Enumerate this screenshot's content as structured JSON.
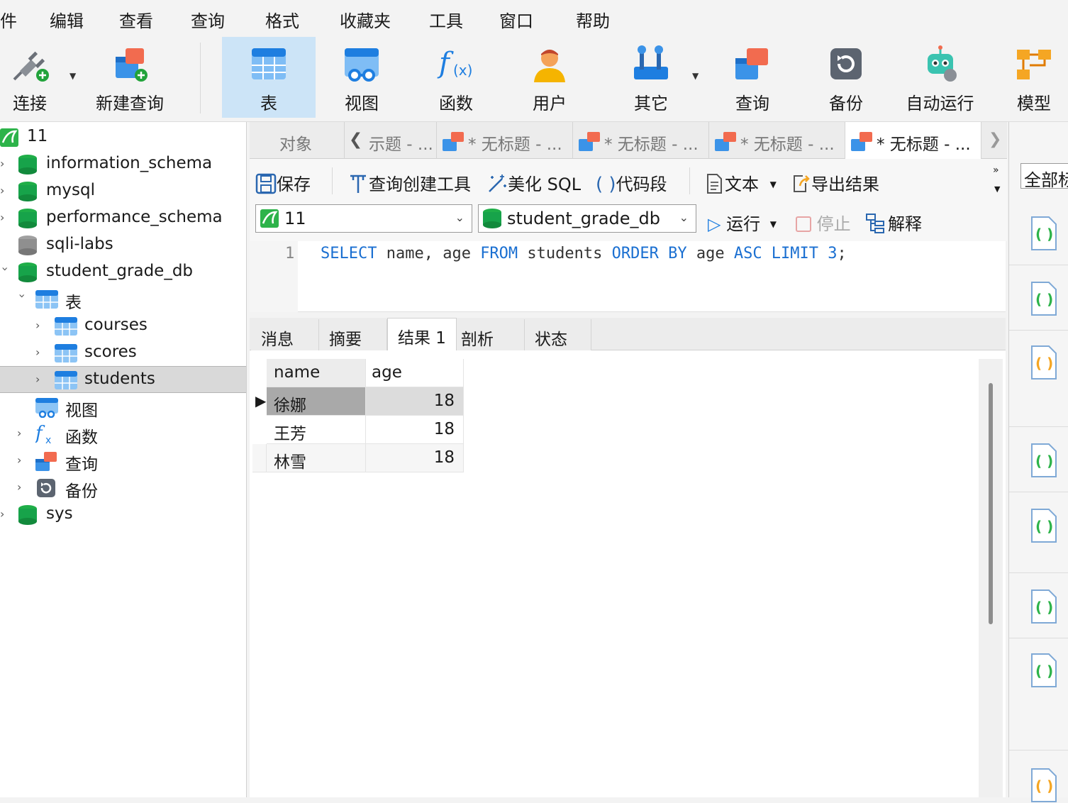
{
  "menu": [
    "件",
    "编辑",
    "查看",
    "查询",
    "格式",
    "收藏夹",
    "工具",
    "窗口",
    "帮助"
  ],
  "ribbon": {
    "connect": "连接",
    "new_query": "新建查询",
    "table": "表",
    "view": "视图",
    "function": "函数",
    "user": "用户",
    "other": "其它",
    "query": "查询",
    "backup": "备份",
    "autorun": "自动运行",
    "model": "模型"
  },
  "navigator": {
    "connection": "11",
    "databases": [
      "information_schema",
      "mysql",
      "performance_schema",
      "sqli-labs",
      "student_grade_db",
      "sys"
    ],
    "tables_label": "表",
    "tables": [
      "courses",
      "scores",
      "students"
    ],
    "views_label": "视图",
    "functions_label": "函数",
    "queries_label": "查询",
    "backups_label": "备份"
  },
  "tabs": {
    "objects": "对象",
    "items": [
      "示题 - ...",
      "* 无标题 - ...",
      "* 无标题 - ...",
      "* 无标题 - ...",
      "* 无标题 - ..."
    ]
  },
  "toolbar": {
    "save": "保存",
    "query_builder": "查询创建工具",
    "beautify": "美化 SQL",
    "snippet": "代码段",
    "text": "文本",
    "export": "导出结果",
    "run": "运行",
    "stop": "停止",
    "explain": "解释"
  },
  "selectors": {
    "connection": "11",
    "database": "student_grade_db"
  },
  "editor": {
    "line_number": "1",
    "sql": {
      "k1": "SELECT",
      "t1": " name, age ",
      "k2": "FROM",
      "t2": " students ",
      "k3": "ORDER BY",
      "t3": " age ",
      "k4": "ASC LIMIT",
      "t4": " ",
      "n1": "3",
      "t5": ";"
    }
  },
  "result_tabs": [
    "消息",
    "摘要",
    "结果 1",
    "剖析",
    "状态"
  ],
  "result": {
    "columns": [
      "name",
      "age"
    ],
    "rows": [
      {
        "name": "徐娜",
        "age": "18"
      },
      {
        "name": "王芳",
        "age": "18"
      },
      {
        "name": "林雪",
        "age": "18"
      }
    ]
  },
  "right_panel": {
    "filter_value": "全部标"
  },
  "colors": {
    "accent": "#1a6fd1",
    "active_tab": "#cce4f7",
    "db_green": "#17a34a"
  }
}
